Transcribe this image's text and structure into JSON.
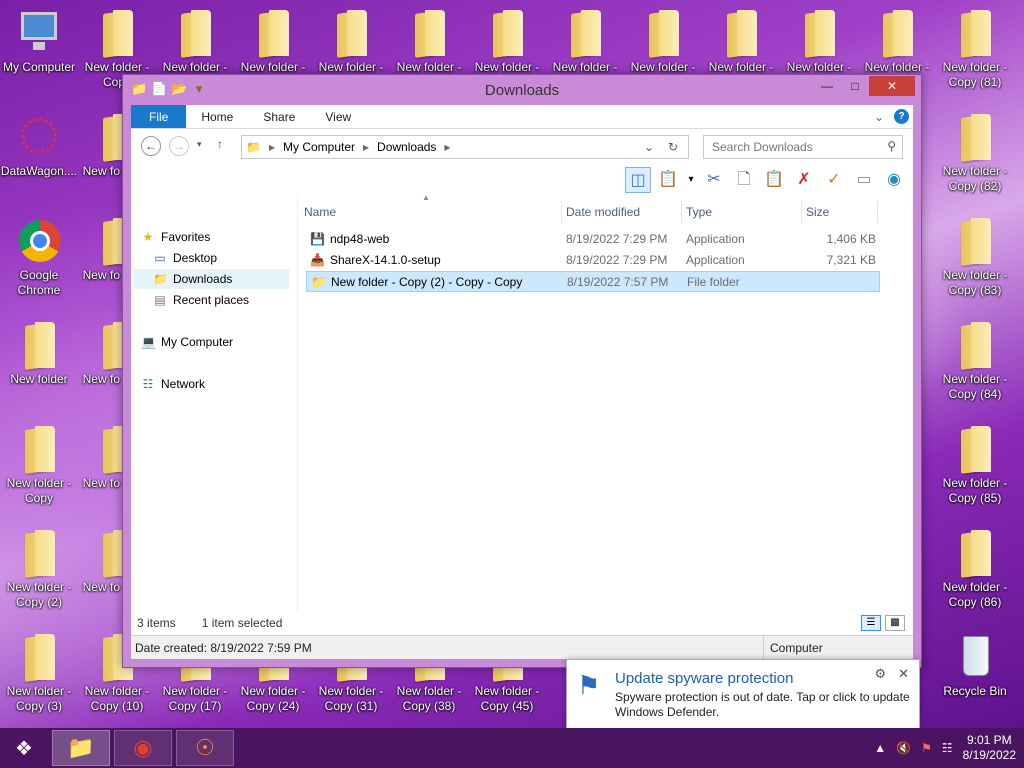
{
  "desktop": {
    "icons_row1": [
      {
        "label": "My Computer",
        "type": "computer"
      },
      {
        "label": "New folder - Copy",
        "type": "folder"
      },
      {
        "label": "New folder -",
        "type": "folder"
      },
      {
        "label": "New folder -",
        "type": "folder"
      },
      {
        "label": "New folder -",
        "type": "folder"
      },
      {
        "label": "New folder -",
        "type": "folder"
      },
      {
        "label": "New folder -",
        "type": "folder"
      },
      {
        "label": "New folder -",
        "type": "folder"
      },
      {
        "label": "New folder -",
        "type": "folder"
      },
      {
        "label": "New folder -",
        "type": "folder"
      },
      {
        "label": "New folder -",
        "type": "folder"
      },
      {
        "label": "New folder -",
        "type": "folder"
      },
      {
        "label": "New folder - Copy (81)",
        "type": "folder"
      }
    ],
    "left_column": [
      {
        "label": "DataWagon....",
        "type": "app"
      },
      {
        "label": "Google Chrome",
        "type": "chrome"
      },
      {
        "label": "New folder",
        "type": "folder"
      },
      {
        "label": "New folder - Copy",
        "type": "folder"
      },
      {
        "label": "New folder - Copy (2)",
        "type": "folder"
      },
      {
        "label": "New folder - Copy (3)",
        "type": "folder"
      }
    ],
    "second_column": [
      {
        "label": "New fo Copy",
        "type": "folder"
      },
      {
        "label": "New fo Copy",
        "type": "folder"
      },
      {
        "label": "New fo Copy",
        "type": "folder"
      },
      {
        "label": "New fo Copy",
        "type": "folder"
      },
      {
        "label": "New fo Copy",
        "type": "folder"
      },
      {
        "label": "New folder - Copy (10)",
        "type": "folder"
      }
    ],
    "right_column": [
      {
        "label": "New folder - Copy (82)",
        "type": "folder"
      },
      {
        "label": "New folder - Copy (83)",
        "type": "folder"
      },
      {
        "label": "New folder - Copy (84)",
        "type": "folder"
      },
      {
        "label": "New folder - Copy (85)",
        "type": "folder"
      },
      {
        "label": "New folder - Copy (86)",
        "type": "folder"
      },
      {
        "label": "Recycle Bin",
        "type": "recycle"
      }
    ],
    "bottom_row": [
      {
        "label": "New folder - Copy (17)",
        "type": "folder"
      },
      {
        "label": "New folder - Copy (24)",
        "type": "folder"
      },
      {
        "label": "New folder - Copy (31)",
        "type": "folder"
      },
      {
        "label": "New folder - Copy (38)",
        "type": "folder"
      },
      {
        "label": "New folder - Copy (45)",
        "type": "folder"
      },
      {
        "label": "Ne C",
        "type": "folder"
      }
    ]
  },
  "window": {
    "title": "Downloads",
    "tabs": [
      "File",
      "Home",
      "Share",
      "View"
    ],
    "breadcrumb": [
      "My Computer",
      "Downloads"
    ],
    "search_placeholder": "Search Downloads",
    "nav": {
      "favorites": "Favorites",
      "desktop": "Desktop",
      "downloads": "Downloads",
      "recent": "Recent places",
      "computer": "My Computer",
      "network": "Network"
    },
    "columns": [
      "Name",
      "Date modified",
      "Type",
      "Size"
    ],
    "files": [
      {
        "name": "ndp48-web",
        "date": "8/19/2022 7:29 PM",
        "type": "Application",
        "size": "1,406 KB",
        "icon": "installer-icon"
      },
      {
        "name": "ShareX-14.1.0-setup",
        "date": "8/19/2022 7:29 PM",
        "type": "Application",
        "size": "7,321 KB",
        "icon": "setup-icon"
      },
      {
        "name": "New folder - Copy (2) - Copy - Copy",
        "date": "8/19/2022 7:57 PM",
        "type": "File folder",
        "size": "",
        "icon": "folder-icon"
      }
    ],
    "status_items": "3 items",
    "status_selected": "1 item selected",
    "details": "Date created: 8/19/2022 7:59 PM",
    "details_right": "Computer"
  },
  "notification": {
    "title": "Update spyware protection",
    "body": "Spyware protection is out of date. Tap or click to update Windows Defender."
  },
  "taskbar": {
    "time": "9:01 PM",
    "date": "8/19/2022"
  }
}
